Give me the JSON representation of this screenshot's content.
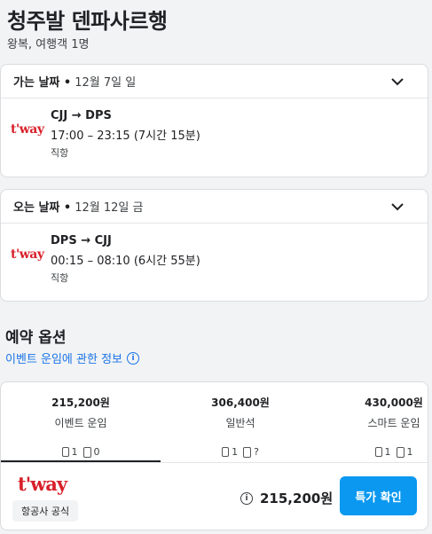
{
  "header": {
    "title": "청주발 덴파사르행",
    "subtitle": "왕복, 여행객 1명"
  },
  "outbound": {
    "direction": "가는 날짜 •",
    "date": "12월 7일 일",
    "airline_logo": "t'way",
    "route": "CJJ → DPS",
    "times": "17:00 – 23:15 (7시간 15분)",
    "stops": "직항"
  },
  "inbound": {
    "direction": "오는 날짜 •",
    "date": "12월 12일 금",
    "airline_logo": "t'way",
    "route": "DPS → CJJ",
    "times": "00:15 – 08:10 (6시간 55분)",
    "stops": "직항"
  },
  "booking": {
    "section_title": "예약 옵션",
    "info_link": "이벤트 운임에 관한 정보",
    "fares": [
      {
        "price": "215,200원",
        "name": "이벤트 운임",
        "carry_on": "1",
        "checked": "0"
      },
      {
        "price": "306,400원",
        "name": "일반석",
        "carry_on": "1",
        "checked": "?"
      },
      {
        "price": "430,000원",
        "name": "스마트 운임",
        "carry_on": "1",
        "checked": "1"
      }
    ],
    "airline_logo": "t'way",
    "badge": "항공사 공식",
    "total_price": "215,200원",
    "cta_label": "특가 확인"
  },
  "colors": {
    "brand_red": "#d8202a",
    "link_blue": "#1a73e8",
    "cta_blue": "#0a98f0"
  }
}
